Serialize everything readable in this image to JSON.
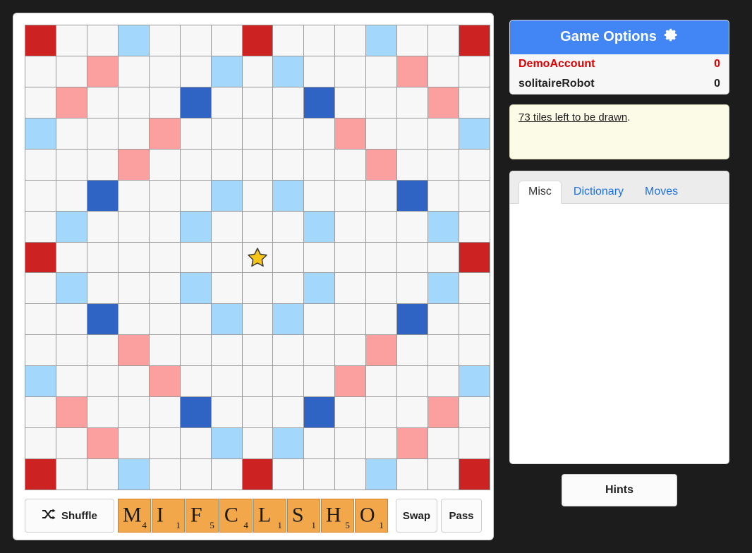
{
  "board": {
    "size": 15,
    "center_icon": "star-icon",
    "legend": {
      "tw": "triple-word",
      "dw": "double-word",
      "tl": "triple-letter",
      "dl": "double-letter",
      "plain": "plain"
    },
    "colors": {
      "triple_word": "#cc2222",
      "double_word": "#fb9f9f",
      "triple_letter": "#2f63c4",
      "double_letter": "#a3d7fb",
      "plain": "#f7f7f7",
      "grid_line": "#9a9a9a",
      "star": "#f5c518"
    },
    "layout": [
      [
        "tw",
        "",
        "",
        "dl",
        "",
        "",
        "",
        "tw",
        "",
        "",
        "",
        "dl",
        "",
        "",
        "tw"
      ],
      [
        "",
        "",
        "dw",
        "",
        "",
        "",
        "dl",
        "",
        "dl",
        "",
        "",
        "",
        "dw",
        "",
        ""
      ],
      [
        "",
        "dw",
        "",
        "",
        "",
        "tl",
        "",
        "",
        "",
        "tl",
        "",
        "",
        "",
        "dw",
        ""
      ],
      [
        "dl",
        "",
        "",
        "",
        "dw",
        "",
        "",
        "",
        "",
        "",
        "dw",
        "",
        "",
        "",
        "dl"
      ],
      [
        "",
        "",
        "",
        "dw",
        "",
        "",
        "",
        "",
        "",
        "",
        "",
        "dw",
        "",
        "",
        ""
      ],
      [
        "",
        "",
        "tl",
        "",
        "",
        "",
        "dl",
        "",
        "dl",
        "",
        "",
        "",
        "tl",
        "",
        ""
      ],
      [
        "",
        "dl",
        "",
        "",
        "",
        "dl",
        "",
        "",
        "",
        "dl",
        "",
        "",
        "",
        "dl",
        ""
      ],
      [
        "tw",
        "",
        "",
        "",
        "",
        "",
        "",
        "center",
        "",
        "",
        "",
        "",
        "",
        "",
        "tw"
      ],
      [
        "",
        "dl",
        "",
        "",
        "",
        "dl",
        "",
        "",
        "",
        "dl",
        "",
        "",
        "",
        "dl",
        ""
      ],
      [
        "",
        "",
        "tl",
        "",
        "",
        "",
        "dl",
        "",
        "dl",
        "",
        "",
        "",
        "tl",
        "",
        ""
      ],
      [
        "",
        "",
        "",
        "dw",
        "",
        "",
        "",
        "",
        "",
        "",
        "",
        "dw",
        "",
        "",
        ""
      ],
      [
        "dl",
        "",
        "",
        "",
        "dw",
        "",
        "",
        "",
        "",
        "",
        "dw",
        "",
        "",
        "",
        "dl"
      ],
      [
        "",
        "dw",
        "",
        "",
        "",
        "tl",
        "",
        "",
        "",
        "tl",
        "",
        "",
        "",
        "dw",
        ""
      ],
      [
        "",
        "",
        "dw",
        "",
        "",
        "",
        "dl",
        "",
        "dl",
        "",
        "",
        "",
        "dw",
        "",
        ""
      ],
      [
        "tw",
        "",
        "",
        "dl",
        "",
        "",
        "",
        "tw",
        "",
        "",
        "",
        "dl",
        "",
        "",
        "tw"
      ]
    ],
    "tiles_on_board": []
  },
  "rack_bar": {
    "shuffle_label": "Shuffle",
    "shuffle_icon": "shuffle-icon",
    "swap_label": "Swap",
    "pass_label": "Pass",
    "tiles": [
      {
        "letter": "M",
        "value": "4"
      },
      {
        "letter": "I",
        "value": "1"
      },
      {
        "letter": "F",
        "value": "5"
      },
      {
        "letter": "C",
        "value": "4"
      },
      {
        "letter": "L",
        "value": "1"
      },
      {
        "letter": "S",
        "value": "1"
      },
      {
        "letter": "H",
        "value": "5"
      },
      {
        "letter": "O",
        "value": "1"
      }
    ]
  },
  "side": {
    "options_header": {
      "title": "Game Options",
      "icon": "gear-icon"
    },
    "players": [
      {
        "name": "DemoAccount",
        "score": "0",
        "active": true
      },
      {
        "name": "solitaireRobot",
        "score": "0",
        "active": false
      }
    ],
    "notice": {
      "link_text": "73 tiles left to be drawn",
      "suffix": "."
    },
    "tabs": [
      {
        "label": "Misc",
        "active": true
      },
      {
        "label": "Dictionary",
        "active": false
      },
      {
        "label": "Moves",
        "active": false
      }
    ],
    "tab_content": "",
    "hints_label": "Hints"
  }
}
